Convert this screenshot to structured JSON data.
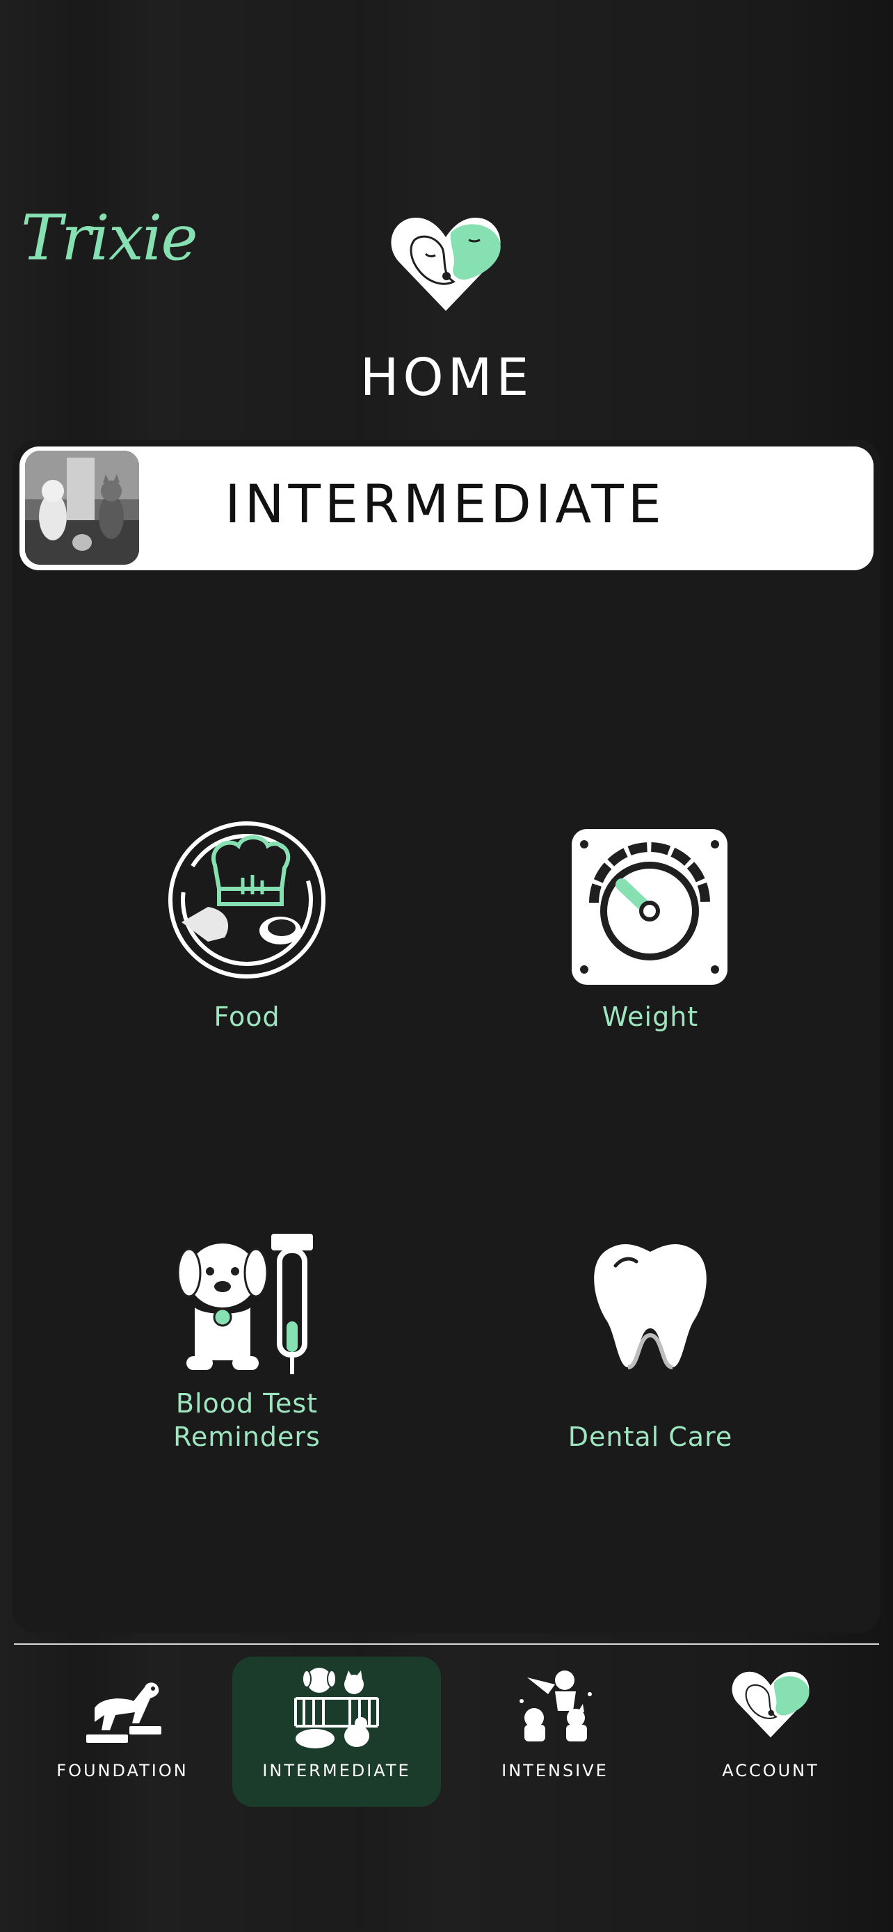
{
  "app": {
    "brand": "Trixie"
  },
  "header": {
    "title": "HOME",
    "logo_icon": "heart-dog-cat-logo-icon"
  },
  "level": {
    "label": "INTERMEDIATE",
    "thumbnail": "dogs-and-cat-photo"
  },
  "tiles": [
    {
      "label": "Food",
      "icon": "chef-hat-food-icon"
    },
    {
      "label": "Weight",
      "icon": "weight-scale-icon"
    },
    {
      "label_line1": "Blood Test",
      "label_line2": "Reminders",
      "icon": "dog-syringe-icon"
    },
    {
      "label": "Dental Care",
      "icon": "tooth-icon"
    }
  ],
  "nav": {
    "active": "INTERMEDIATE",
    "items": [
      {
        "label": "FOUNDATION",
        "icon": "dog-steps-icon"
      },
      {
        "label": "INTERMEDIATE",
        "icon": "pets-pen-icon"
      },
      {
        "label": "INTENSIVE",
        "icon": "superhero-pets-icon"
      },
      {
        "label": "ACCOUNT",
        "icon": "heart-dog-cat-logo-icon"
      }
    ]
  },
  "colors": {
    "accent": "#86e0b2",
    "label_green": "#9ee6c0",
    "background": "#1f1f1f",
    "panel": "#1a1a1a",
    "active_nav": "#1c3c2b"
  }
}
